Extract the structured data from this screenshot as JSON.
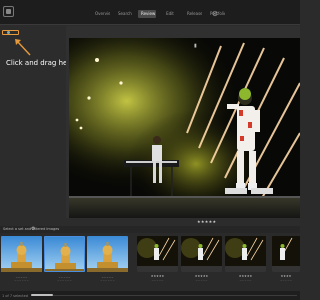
{
  "topbar": {
    "tabs": [
      "Overview",
      "Search",
      "Review",
      "Edit",
      "Release",
      "Portfolio"
    ],
    "active_tab_index": 2,
    "settings_icon": "gear-icon"
  },
  "left_panel": {
    "hint": "Click and drag here"
  },
  "viewer": {
    "zoom_label": "▮",
    "rating": "★★★★★",
    "caption": "_ _ _ _ _"
  },
  "filmstrip": {
    "title": "Select a set and Filtered Images",
    "items": [
      {
        "title": "_ _ _ _ _",
        "sub": "_ _ _ _ _ _",
        "kind": "tower"
      },
      {
        "title": "_ _ _ _ _",
        "sub": "_ _ _ _ _ _",
        "kind": "tower"
      },
      {
        "title": "_ _ _ _ _",
        "sub": "_ _ _ _ _ _",
        "kind": "tower"
      },
      {
        "title": "★★★★★",
        "sub": "_ _ _ _ _",
        "kind": "stage"
      },
      {
        "title": "★★★★★",
        "sub": "_ _ _ _ _",
        "kind": "stage"
      },
      {
        "title": "★★★★★",
        "sub": "_ _ _ _ _",
        "kind": "stage"
      },
      {
        "title": "★★★★",
        "sub": "_ _ _ _ _",
        "kind": "stage"
      }
    ]
  },
  "status": {
    "text": "1 of 7 selected"
  },
  "colors": {
    "accent": "#e69a3c",
    "background": "#2c2c2c"
  }
}
